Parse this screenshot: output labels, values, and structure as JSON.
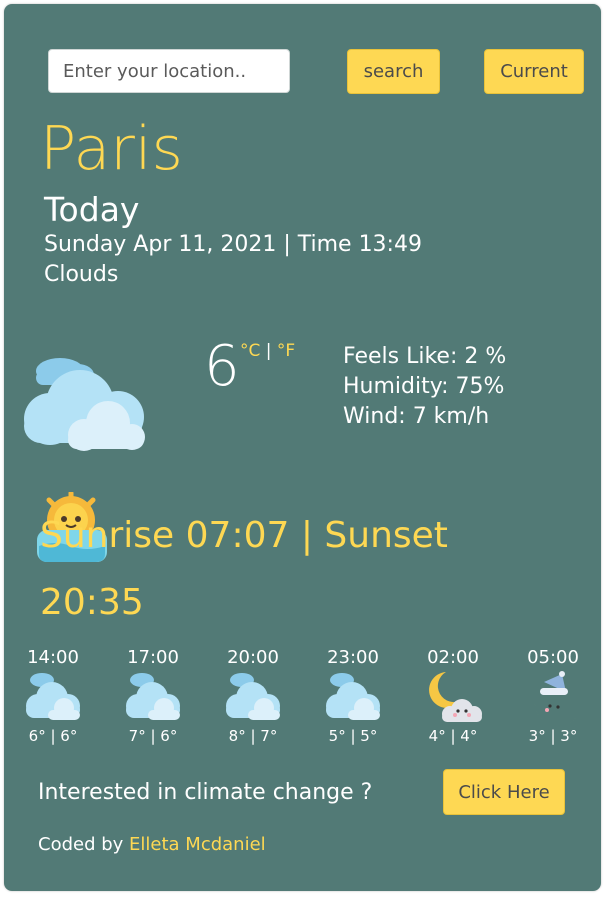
{
  "search": {
    "placeholder": "Enter your location..",
    "button_label": "search",
    "current_label": "Current"
  },
  "weather": {
    "city": "Paris",
    "day_label": "Today",
    "date_time": "Sunday Apr 11, 2021 | Time 13:49",
    "description": "Clouds",
    "temperature": "6",
    "unit_c": "°C",
    "unit_sep": " | ",
    "unit_f": "°F",
    "feels_like": "Feels Like: 2 %",
    "humidity": "Humidity: 75%",
    "wind": "Wind: 7 km/h",
    "icon": "clouds-icon"
  },
  "sun": {
    "text": "Sunrise 07:07 | Sunset 20:35",
    "icon": "sunrise-icon"
  },
  "forecast": [
    {
      "time": "14:00",
      "temps": "6° | 6°",
      "icon": "clouds-icon"
    },
    {
      "time": "17:00",
      "temps": "7° | 6°",
      "icon": "clouds-icon"
    },
    {
      "time": "20:00",
      "temps": "8° | 7°",
      "icon": "clouds-icon"
    },
    {
      "time": "23:00",
      "temps": "5° | 5°",
      "icon": "clouds-icon"
    },
    {
      "time": "02:00",
      "temps": "4° | 4°",
      "icon": "moon-cloud-icon"
    },
    {
      "time": "05:00",
      "temps": "3° | 3°",
      "icon": "moon-sleep-icon"
    }
  ],
  "climate": {
    "text": "Interested in climate change ?",
    "button_label": "Click Here"
  },
  "credit": {
    "prefix": "Coded by ",
    "author": "Elleta Mcdaniel"
  },
  "colors": {
    "background": "#527a76",
    "accent": "#fed853",
    "text": "#ffffff"
  }
}
